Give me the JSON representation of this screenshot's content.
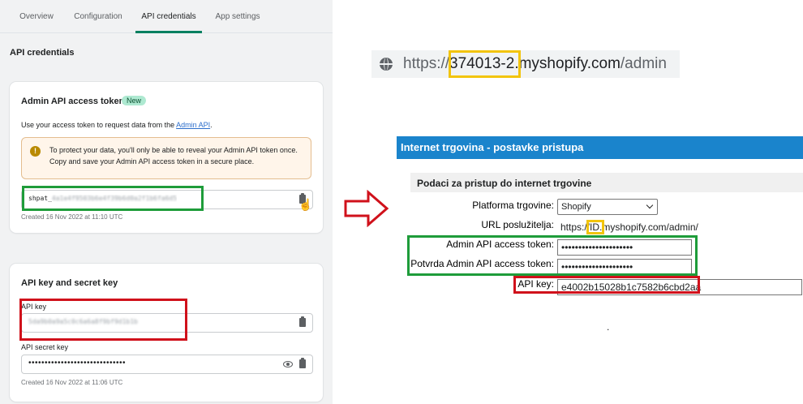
{
  "tabs": [
    {
      "label": "Overview"
    },
    {
      "label": "Configuration"
    },
    {
      "label": "API credentials"
    },
    {
      "label": "App settings"
    }
  ],
  "section_title": "API credentials",
  "token_card": {
    "title": "Admin API access token",
    "badge": "New",
    "help_prefix": "Use your access token to request data from the ",
    "help_link": "Admin API",
    "help_suffix": ".",
    "banner": "To protect your data, you'll only be able to reveal your Admin API token once. Copy and save your Admin API access token in a secure place.",
    "token_prefix": "shpat_",
    "token_masked": "4a1e4f9503b6e4f39b6d0a2f1b6fa6d5",
    "created": "Created 16 Nov 2022 at 11:10 UTC"
  },
  "key_card": {
    "title": "API key and secret key",
    "api_key_label": "API key",
    "api_key_masked": "5da9b0a9a5c0c6a6a8f9bf9d1b1b",
    "secret_label": "API secret key",
    "secret_value": "••••••••••••••••••••••••••••••",
    "created": "Created 16 Nov 2022 at 11:06 UTC"
  },
  "url": {
    "prefix": "https://",
    "id": "374013-2",
    "suffix_mid": ".myshopify.com",
    "suffix_end": "/admin"
  },
  "form": {
    "header": "Internet trgovina - postavke pristupa",
    "section": "Podaci za pristup do internet trgovine",
    "platform_label": "Platforma trgovine:",
    "platform_value": "Shopify",
    "url_label": "URL poslužitelja:",
    "url_prefix": "https://",
    "url_id": "ID",
    "url_suffix": ".myshopify.com/admin/",
    "token_label": "Admin API access token:",
    "token_value": "•••••••••••••••••••••",
    "confirm_label": "Potvrda Admin API access token:",
    "confirm_value": "•••••••••••••••••••••",
    "apikey_label": "API key:",
    "apikey_value": "e4002b15028b1c7582b6cbd2aa",
    "dot": "."
  },
  "colors": {
    "shopify_green": "#008060",
    "highlight_green": "#1e9c3a",
    "highlight_red": "#d0111b",
    "highlight_yellow": "#f2c40c",
    "form_header_blue": "#1a84cc",
    "arrow_red": "#d0111b"
  }
}
